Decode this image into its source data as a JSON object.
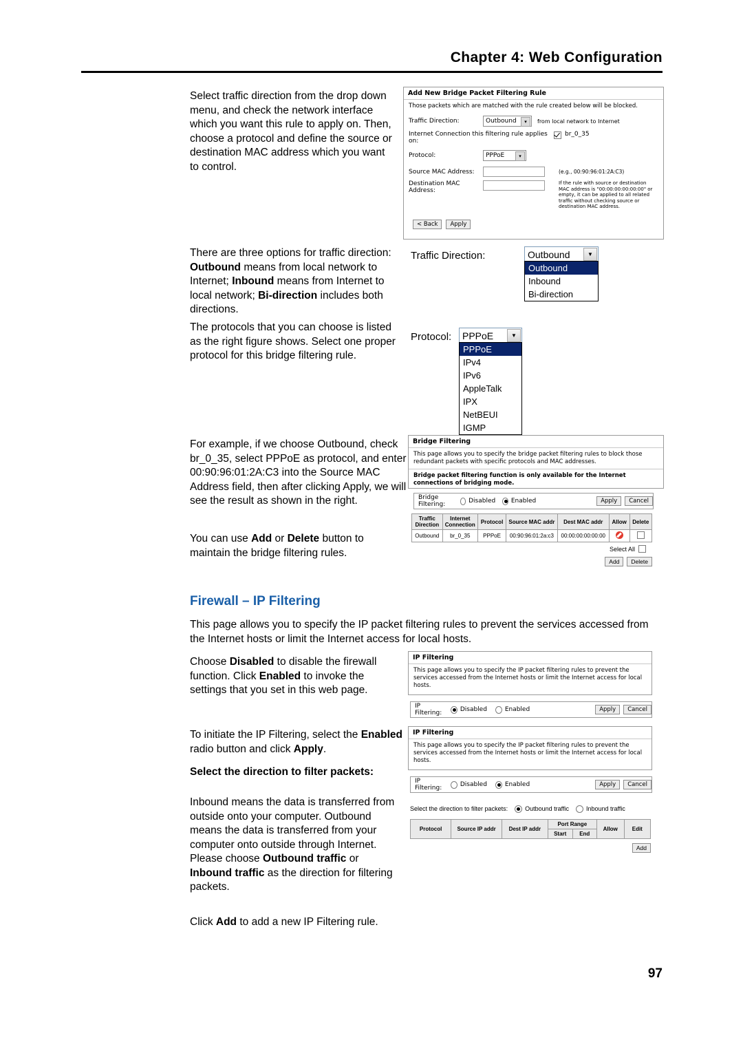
{
  "header": {
    "chapter": "Chapter 4: Web Configuration",
    "page_number": "97"
  },
  "body": {
    "p1": "Select traffic direction from the drop down menu, and check the network interface which you want this rule to apply on. Then, choose a protocol and define the source or destination MAC address which you want to control.",
    "p2_parts": [
      "There are three options for traffic direction: ",
      "Outbound",
      " means from local network to Internet; ",
      "Inbound",
      " means from Internet to local network; ",
      "Bi-direction",
      " includes both directions."
    ],
    "p3": "The protocols that you can choose is listed as the right figure shows. Select one proper protocol for this bridge filtering rule.",
    "p4": "For example, if we choose Outbound, check br_0_35, select PPPoE as protocol, and enter 00:90:96:01:2A:C3 into the Source MAC Address field, then after clicking Apply, we will see the result as shown in the right.",
    "p5_parts": [
      "You can use ",
      "Add",
      " or ",
      "Delete",
      " button to maintain the bridge filtering rules."
    ],
    "section_title": "Firewall – IP Filtering",
    "p6": "This page allows you to specify the IP packet filtering rules to prevent the services accessed from the Internet hosts or limit the Internet access for local hosts.",
    "p7_parts": [
      "Choose ",
      "Disabled",
      " to disable the firewall function. Click ",
      "Enabled",
      " to invoke the settings that you set in this web page."
    ],
    "p8_parts": [
      "To initiate the IP Filtering, select the ",
      "Enabled",
      " radio button and click ",
      "Apply",
      "."
    ],
    "p9": "Select the direction to filter packets:",
    "p10_parts": [
      "Inbound means the data is transferred from outside onto your computer. Outbound means the data is transferred from your computer onto outside through Internet. Please choose ",
      "Outbound traffic",
      " or ",
      "Inbound traffic",
      " as the direction for filtering packets."
    ],
    "p11_parts": [
      "Click ",
      "Add",
      " to add a new IP Filtering rule."
    ]
  },
  "fig_add_rule": {
    "title": "Add New Bridge Packet Filtering Rule",
    "note": "Those packets which are matched with the rule created below will be blocked.",
    "traffic_direction_label": "Traffic Direction:",
    "traffic_direction_value": "Outbound",
    "traffic_direction_hint": "from local network to Internet",
    "interface_label": "Internet Connection this filtering rule applies on:",
    "interface_checkbox_label": "br_0_35",
    "protocol_label": "Protocol:",
    "protocol_value": "PPPoE",
    "src_label": "Source MAC Address:",
    "src_value": "",
    "dst_label": "Destination MAC Address:",
    "dst_value": "",
    "mac_example": "(e.g., 00:90:96:01:2A:C3)",
    "mac_note": "If the rule with source or destination MAC address is \"00:00:00:00:00:00\" or empty, it can be applied to all related traffic without checking source or destination MAC address.",
    "back_button": "< Back",
    "apply_button": "Apply"
  },
  "fig_direction": {
    "label": "Traffic Direction:",
    "selected": "Outbound",
    "options": [
      "Outbound",
      "Inbound",
      "Bi-direction"
    ]
  },
  "fig_protocol": {
    "label": "Protocol:",
    "selected": "PPPoE",
    "options": [
      "PPPoE",
      "IPv4",
      "IPv6",
      "AppleTalk",
      "IPX",
      "NetBEUI",
      "IGMP"
    ]
  },
  "fig_bridge": {
    "title": "Bridge Filtering",
    "note1": "This page allows you to specify the bridge packet filtering rules to block those redundant packets with specific protocols and MAC addresses.",
    "note2": "Bridge packet filtering function is only available for the Internet connections of bridging mode.",
    "toggle_label": "Bridge Filtering:",
    "disabled_label": "Disabled",
    "enabled_label": "Enabled",
    "selected_state": "Enabled",
    "apply_button": "Apply",
    "cancel_button": "Cancel",
    "columns": [
      "Traffic Direction",
      "Internet Connection",
      "Protocol",
      "Source MAC addr",
      "Dest MAC addr",
      "Allow",
      "Delete"
    ],
    "rows": [
      [
        "Outbound",
        "br_0_35",
        "PPPoE",
        "00:90:96:01:2a:c3",
        "00:00:00:00:00:00",
        "blocked",
        ""
      ]
    ],
    "select_all_label": "Select All",
    "add_button": "Add",
    "delete_button": "Delete"
  },
  "fig_ipf1": {
    "title": "IP Filtering",
    "note": "This page allows you to specify the IP packet filtering rules to prevent the services accessed from the Internet hosts or limit the Internet access for local hosts.",
    "toggle_label": "IP Filtering:",
    "disabled_label": "Disabled",
    "enabled_label": "Enabled",
    "selected_state": "Disabled",
    "apply_button": "Apply",
    "cancel_button": "Cancel"
  },
  "fig_ipf2": {
    "title": "IP Filtering",
    "note": "This page allows you to specify the IP packet filtering rules to prevent the services accessed from the Internet hosts or limit the Internet access for local hosts.",
    "toggle_label": "IP Filtering:",
    "disabled_label": "Disabled",
    "enabled_label": "Enabled",
    "selected_state": "Enabled",
    "apply_button": "Apply",
    "cancel_button": "Cancel",
    "direction_label": "Select the direction to filter packets:",
    "outbound_label": "Outbound traffic",
    "inbound_label": "Inbound traffic",
    "selected_direction": "Outbound traffic",
    "columns": [
      "Protocol",
      "Source IP addr",
      "Dest IP addr",
      "Port Range",
      "Allow",
      "Edit"
    ],
    "subcolumns": [
      "Start",
      "End"
    ],
    "add_button": "Add"
  }
}
